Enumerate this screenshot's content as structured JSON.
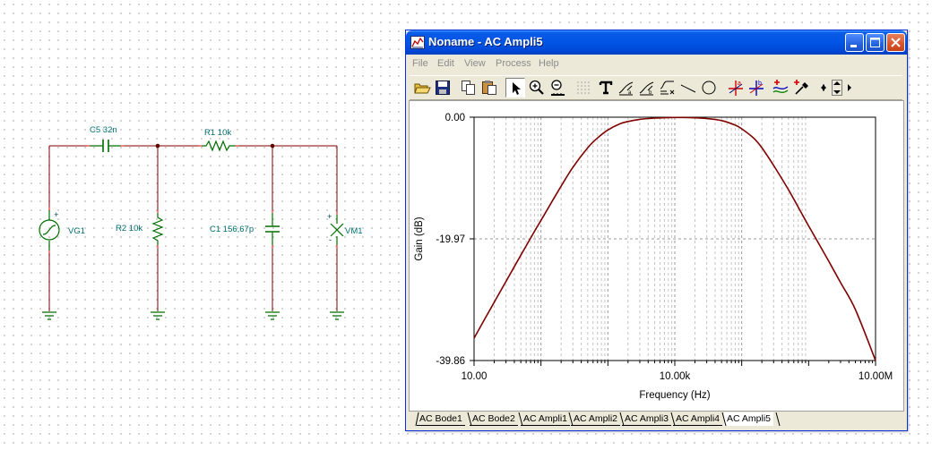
{
  "schematic": {
    "components": {
      "c5": "C5 32n",
      "r1": "R1 10k",
      "r2": "R2 10k",
      "c1": "C1 156,67p",
      "vg1": "VG1",
      "vm1": "VM1"
    },
    "colors": {
      "wire": "#800000",
      "part": "#006e00",
      "label": "#006e6e",
      "node": "#600000",
      "pin": "#ff0000"
    }
  },
  "window": {
    "title": "Noname - AC Ampli5",
    "menu": [
      "File",
      "Edit",
      "View",
      "Process",
      "Help"
    ],
    "toolbar_icons": [
      "open-icon",
      "save-icon",
      "copy-icon",
      "paste-icon",
      "pointer-icon",
      "zoom-in-icon",
      "zoom-100-icon",
      "grid-icon",
      "text-icon",
      "cursor-a-icon",
      "cursor-b-icon",
      "line-settings-icon",
      "line-icon",
      "circle-icon",
      "marker-a-icon",
      "marker-b-icon",
      "add-curve-icon",
      "pipette-icon",
      "scroll-arrows-icon"
    ],
    "tabs": [
      "AC Bode1",
      "AC Bode2",
      "AC Ampli1",
      "AC Ampli2",
      "AC Ampli3",
      "AC Ampli4",
      "AC Ampli5"
    ],
    "active_tab": 6
  },
  "chart_data": {
    "type": "line",
    "title": "",
    "xlabel": "Frequency (Hz)",
    "ylabel": "Gain (dB)",
    "xscale": "log",
    "xlim": [
      10,
      10000000
    ],
    "ylim": [
      -39.86,
      0
    ],
    "x_tick_labels": [
      "10.00",
      "10.00k",
      "10.00M"
    ],
    "y_tick_labels": [
      "0.00",
      "-19.97",
      "-39.86"
    ],
    "grid": true,
    "line_color": "#800000",
    "series": [
      {
        "x": [
          10,
          20,
          30,
          50,
          80,
          100,
          150,
          200,
          300,
          500,
          700,
          1000,
          1500,
          2000,
          3000,
          5000,
          10000,
          20000,
          30000,
          50000,
          80000,
          100000,
          150000,
          200000,
          300000,
          500000,
          800000,
          1000000,
          2000000,
          3000000,
          5000000,
          10000000
        ],
        "y": [
          -36.2,
          -30.3,
          -26.9,
          -22.6,
          -18.7,
          -16.9,
          -13.6,
          -11.3,
          -8.2,
          -5.0,
          -3.4,
          -2.1,
          -1.1,
          -0.7,
          -0.35,
          -0.15,
          -0.05,
          -0.1,
          -0.22,
          -0.55,
          -1.3,
          -1.9,
          -3.4,
          -5.0,
          -7.9,
          -11.9,
          -15.9,
          -17.8,
          -23.6,
          -27.1,
          -31.5,
          -39.86
        ]
      }
    ]
  }
}
